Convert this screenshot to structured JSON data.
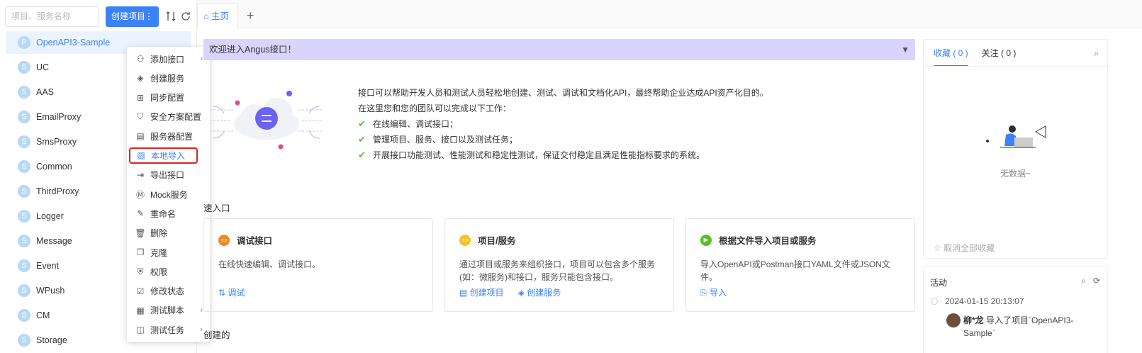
{
  "sidebar": {
    "search_placeholder": "项目、服务名称",
    "create_button": "创建项目",
    "create_more": "⋮",
    "items": [
      {
        "avatar": "P",
        "name": "OpenAPI3-Sample"
      },
      {
        "avatar": "S",
        "name": "UC"
      },
      {
        "avatar": "S",
        "name": "AAS"
      },
      {
        "avatar": "S",
        "name": "EmailProxy"
      },
      {
        "avatar": "S",
        "name": "SmsProxy"
      },
      {
        "avatar": "S",
        "name": "Common"
      },
      {
        "avatar": "S",
        "name": "ThirdProxy"
      },
      {
        "avatar": "S",
        "name": "Logger"
      },
      {
        "avatar": "S",
        "name": "Message"
      },
      {
        "avatar": "S",
        "name": "Event"
      },
      {
        "avatar": "S",
        "name": "WPush"
      },
      {
        "avatar": "S",
        "name": "CM"
      },
      {
        "avatar": "S",
        "name": "Storage"
      }
    ]
  },
  "context_menu": {
    "items": [
      {
        "label": "添加接口",
        "icon": "add-api-icon",
        "submenu": true
      },
      {
        "label": "创建服务",
        "icon": "create-service-icon"
      },
      {
        "label": "同步配置",
        "icon": "sync-config-icon"
      },
      {
        "label": "安全方案配置",
        "icon": "security-scheme-icon"
      },
      {
        "label": "服务器配置",
        "icon": "server-config-icon"
      },
      {
        "label": "本地导入",
        "icon": "local-import-icon",
        "selected": true
      },
      {
        "label": "导出接口",
        "icon": "export-api-icon"
      },
      {
        "label": "Mock服务",
        "icon": "mock-service-icon"
      },
      {
        "label": "重命名",
        "icon": "rename-icon"
      },
      {
        "label": "删除",
        "icon": "delete-icon"
      },
      {
        "label": "克隆",
        "icon": "clone-icon"
      },
      {
        "label": "权限",
        "icon": "permission-icon"
      },
      {
        "label": "修改状态",
        "icon": "modify-status-icon"
      },
      {
        "label": "测试脚本",
        "icon": "test-script-icon",
        "submenu": true
      },
      {
        "label": "测试任务",
        "icon": "test-task-icon",
        "submenu": true
      }
    ]
  },
  "tabs": {
    "home": "主页",
    "add": "+"
  },
  "main": {
    "banner": "欢迎进入Angus接口！",
    "intro": {
      "line1": "接口可以帮助开发人员和测试人员轻松地创建、测试、调试和文档化API，最终帮助企业达成API资产化目的。",
      "line2": "在这里您和您的团队可以完成以下工作：",
      "bullets": [
        "在线编辑、调试接口；",
        "管理项目、服务、接口以及测试任务；",
        "开展接口功能测试、性能测试和稳定性测试，保证交付稳定且满足性能指标要求的系统。"
      ]
    },
    "quick_title": "速入口",
    "cards": [
      {
        "title": "调试接口",
        "desc": "在线快速编辑、调试接口。",
        "links": [
          "调试"
        ],
        "color": "#f08a24"
      },
      {
        "title": "项目/服务",
        "desc": "通过项目或服务来组织接口，项目可以包含多个服务(如：微服务)和接口，服务只能包含接口。",
        "links": [
          "创建项目",
          "创建服务"
        ],
        "color": "#f5c02a"
      },
      {
        "title": "根据文件导入项目或服务",
        "desc": "导入OpenAPI或Postman接口YAML文件或JSON文件。",
        "links": [
          "导入"
        ],
        "color": "#52c41a"
      }
    ],
    "recent_title": "创建的"
  },
  "right": {
    "fav_tab": "收藏 ( 0 )",
    "follow_tab": "关注 ( 0 )",
    "empty": "无数据~",
    "cancel_all": "取消全部收藏",
    "activity_title": "活动",
    "activity": {
      "time": "2024-01-15 20:13:07",
      "user": "柳*龙",
      "text": " 导入了项目`OpenAPI3-Sample`"
    }
  },
  "colors": {
    "accent": "#3b82f6",
    "banner": "#d9d4fb",
    "highlight_border": "#d9261c"
  }
}
